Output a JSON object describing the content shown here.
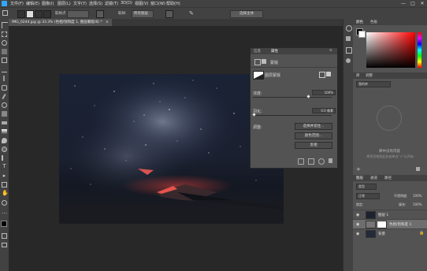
{
  "menubar": {
    "items": [
      "文件(F)",
      "编辑(E)",
      "图像(I)",
      "图层(L)",
      "文字(Y)",
      "选择(S)",
      "滤镜(T)",
      "3D(D)",
      "视图(V)",
      "窗口(W)",
      "帮助(H)"
    ],
    "win_controls": [
      "—",
      "□",
      "✕"
    ]
  },
  "options": {
    "sample_size": "取样点",
    "sample_label": "取样:",
    "sample_value": "所有图层",
    "select_subject": "选择主体"
  },
  "document": {
    "tab_title": "IMG_0244.jpg @ 33.3% (色相/饱和度 1, 图层蒙版/8) *",
    "tab_close": "×"
  },
  "properties": {
    "tab1": "信息",
    "tab2": "属性",
    "section_title": "蒙版",
    "layer_mask_label": "图层蒙版",
    "density_label": "浓度:",
    "density_value": "100%",
    "density_fraction": 1.0,
    "feather_label": "羽化:",
    "feather_value": "0.0 像素",
    "feather_fraction": 0.0,
    "refine_label": "调整:",
    "btn_select_mask": "选择并遮住...",
    "btn_color_range": "颜色范围...",
    "btn_invert": "反相"
  },
  "right_panel": {
    "tab_color": "颜色",
    "tab_swatches": "色板",
    "tab_libraries": "库",
    "tab_adjust": "调整",
    "library_select": "我的库",
    "library_empty_title": "库中没有内容",
    "library_empty_desc": "将项目拖到此处或单击“+”以开始",
    "layers_tab": "图层",
    "channels_tab": "通道",
    "paths_tab": "路径",
    "kind_label": "类型",
    "blend_mode": "正常",
    "opacity_label": "不透明度:",
    "opacity_value": "100%",
    "lock_label": "锁定:",
    "fill_label": "填充:",
    "fill_value": "100%",
    "layers": [
      {
        "name": "图层 1",
        "selected": false
      },
      {
        "name": "色相/饱和度 1",
        "selected": true
      },
      {
        "name": "背景",
        "selected": false
      }
    ]
  },
  "colors": {
    "accent": "#d9534f",
    "panel": "#535353",
    "dark": "#424242"
  }
}
